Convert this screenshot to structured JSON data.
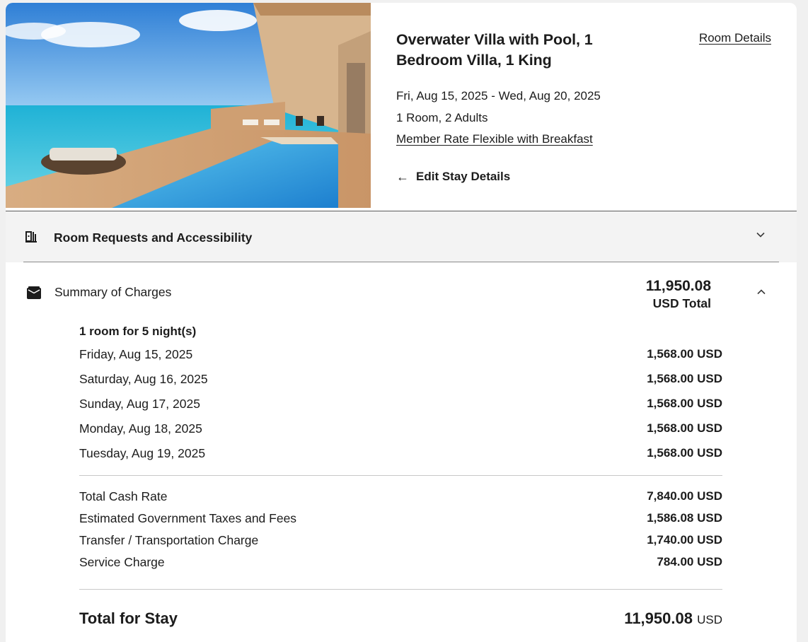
{
  "room": {
    "title": "Overwater Villa with Pool, 1 Bedroom Villa, 1 King",
    "details_link": "Room Details",
    "dates": "Fri, Aug 15, 2025 - Wed, Aug 20, 2025",
    "occupancy": "1 Room, 2 Adults",
    "rate_name": "Member Rate Flexible with Breakfast",
    "edit_stay": "Edit Stay Details",
    "photo_icon": "overwater-villa-photo"
  },
  "requests": {
    "label": "Room Requests and Accessibility",
    "icon": "door-luggage-icon"
  },
  "summary": {
    "label": "Summary of Charges",
    "icon": "wallet-icon",
    "total_amount": "11,950.08",
    "total_label": "USD Total",
    "nights_heading": "1 room for 5 night(s)",
    "nights": [
      {
        "date": "Friday, Aug 15, 2025",
        "amount": "1,568.00 USD"
      },
      {
        "date": "Saturday, Aug 16, 2025",
        "amount": "1,568.00 USD"
      },
      {
        "date": "Sunday, Aug 17, 2025",
        "amount": "1,568.00 USD"
      },
      {
        "date": "Monday, Aug 18, 2025",
        "amount": "1,568.00 USD"
      },
      {
        "date": "Tuesday, Aug 19, 2025",
        "amount": "1,568.00 USD"
      }
    ],
    "charges": [
      {
        "label": "Total Cash Rate",
        "amount": "7,840.00 USD"
      },
      {
        "label": "Estimated Government Taxes and Fees",
        "amount": "1,586.08 USD"
      },
      {
        "label": "Transfer / Transportation Charge",
        "amount": "1,740.00 USD"
      },
      {
        "label": "Service Charge",
        "amount": "784.00 USD"
      }
    ],
    "grand_label": "Total for Stay",
    "grand_amount": "11,950.08",
    "grand_currency": "USD"
  }
}
